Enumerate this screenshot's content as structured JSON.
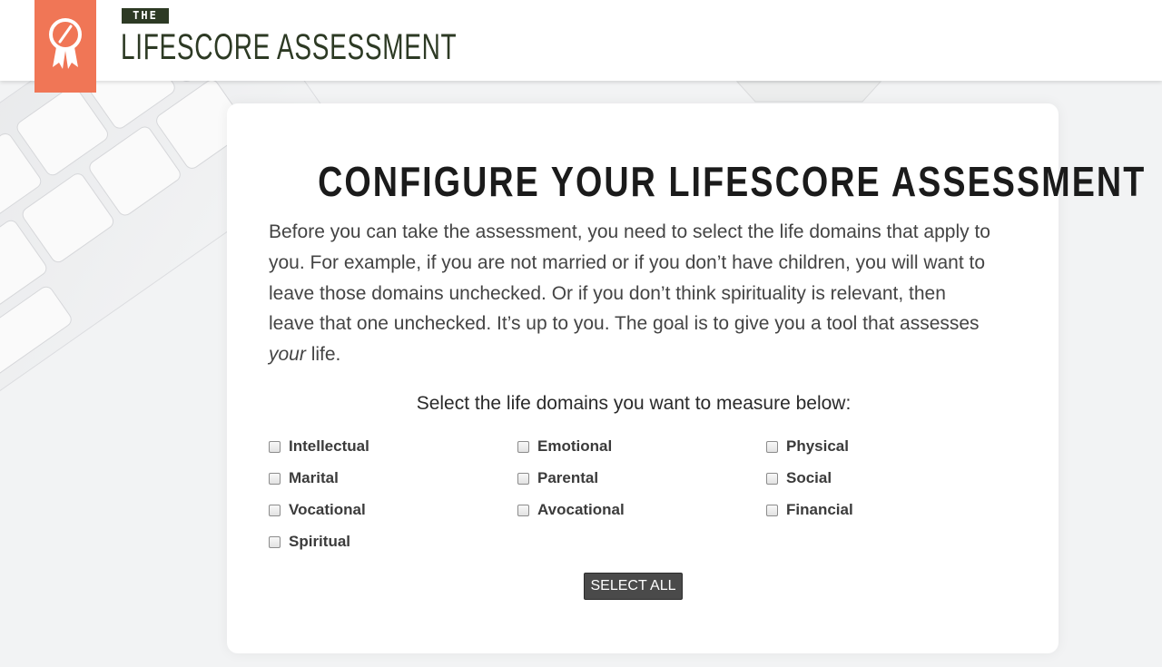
{
  "brand": {
    "the": "THE",
    "title": "LIFESCORE ASSESSMENT",
    "badge_color": "#f07656",
    "text_color": "#2d3a24",
    "accent_teal": "#1f8f9a",
    "icon": "award-ribbon-icon"
  },
  "card": {
    "title": "CONFIGURE YOUR LIFESCORE ASSESSMENT",
    "intro_before": "Before you can take the assessment, you need to select the life domains that apply to you. For example, if you are not married or if you don’t have children, you will want to leave those domains unchecked. Or if you don’t think spirituality is relevant, then leave that one unchecked. It’s up to you. The goal is to give you a tool that assesses ",
    "intro_emphasis": "your",
    "intro_after": " life.",
    "select_label": "Select the life domains you want to measure below:",
    "domains": [
      {
        "label": "Intellectual",
        "checked": false
      },
      {
        "label": "Emotional",
        "checked": false
      },
      {
        "label": "Physical",
        "checked": false
      },
      {
        "label": "Marital",
        "checked": false
      },
      {
        "label": "Parental",
        "checked": false
      },
      {
        "label": "Social",
        "checked": false
      },
      {
        "label": "Vocational",
        "checked": false
      },
      {
        "label": "Avocational",
        "checked": false
      },
      {
        "label": "Financial",
        "checked": false
      },
      {
        "label": "Spiritual",
        "checked": false
      }
    ],
    "select_all_label": "SELECT ALL"
  }
}
